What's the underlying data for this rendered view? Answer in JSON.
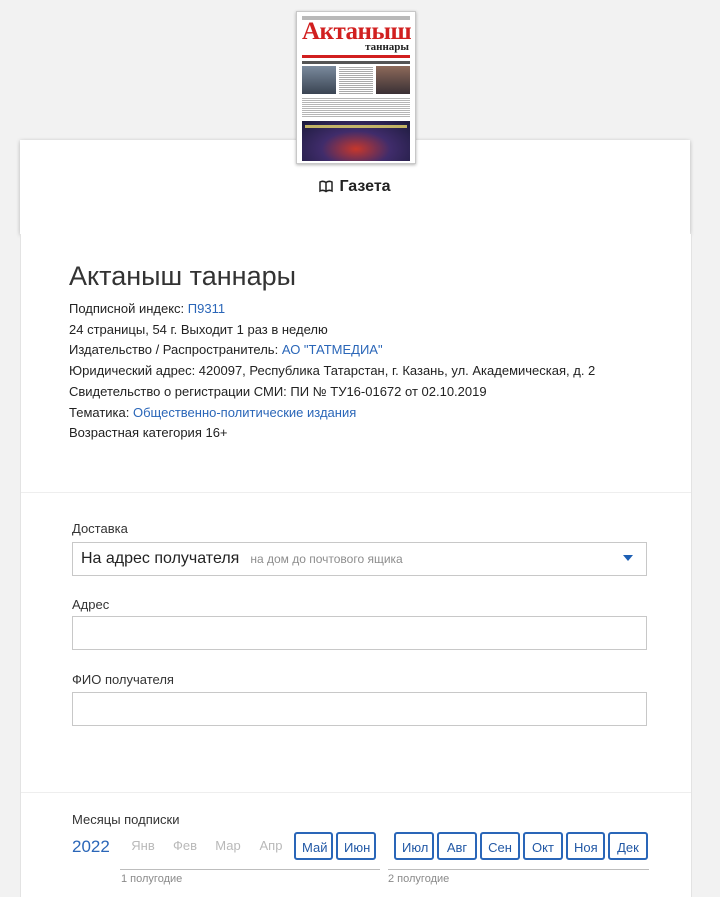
{
  "publication": {
    "type_label": "Газета",
    "title": "Актаныш таннары",
    "subscription_index_label": "Подписной индекс:",
    "subscription_index": "П9311",
    "pages_line": "24 страницы, 54 г. Выходит 1 раз в неделю",
    "publisher_label": "Издательство / Распространитель:",
    "publisher": "АО \"ТАТМЕДИА\"",
    "legal_address": "Юридический адрес: 420097, Республика Татарстан, г. Казань, ул. Академическая, д. 2",
    "registration": "Свидетельство о регистрации СМИ: ПИ № ТУ16-01672 от 02.10.2019",
    "topic_label": "Тематика:",
    "topic": "Общественно-политические издания",
    "age_category": "Возрастная категория 16+"
  },
  "cover": {
    "masthead": "Актаныш",
    "masthead_sub": "таннары"
  },
  "form": {
    "delivery_label": "Доставка",
    "delivery_value": "На адрес получателя",
    "delivery_hint": "на дом до почтового ящика",
    "address_label": "Адрес",
    "address_value": "",
    "recipient_label": "ФИО получателя",
    "recipient_value": ""
  },
  "subscription": {
    "label": "Месяцы подписки",
    "year": "2022",
    "months": [
      {
        "label": "Янв",
        "available": false
      },
      {
        "label": "Фев",
        "available": false
      },
      {
        "label": "Мар",
        "available": false
      },
      {
        "label": "Апр",
        "available": false
      },
      {
        "label": "Май",
        "available": true
      },
      {
        "label": "Июн",
        "available": true
      },
      {
        "label": "Июл",
        "available": true
      },
      {
        "label": "Авг",
        "available": true
      },
      {
        "label": "Сен",
        "available": true
      },
      {
        "label": "Окт",
        "available": true
      },
      {
        "label": "Ноя",
        "available": true
      },
      {
        "label": "Дек",
        "available": true
      }
    ],
    "half1_label": "1 полугодие",
    "half2_label": "2 полугодие"
  },
  "colors": {
    "accent": "#2a66b8",
    "masthead_red": "#d11f1f"
  }
}
